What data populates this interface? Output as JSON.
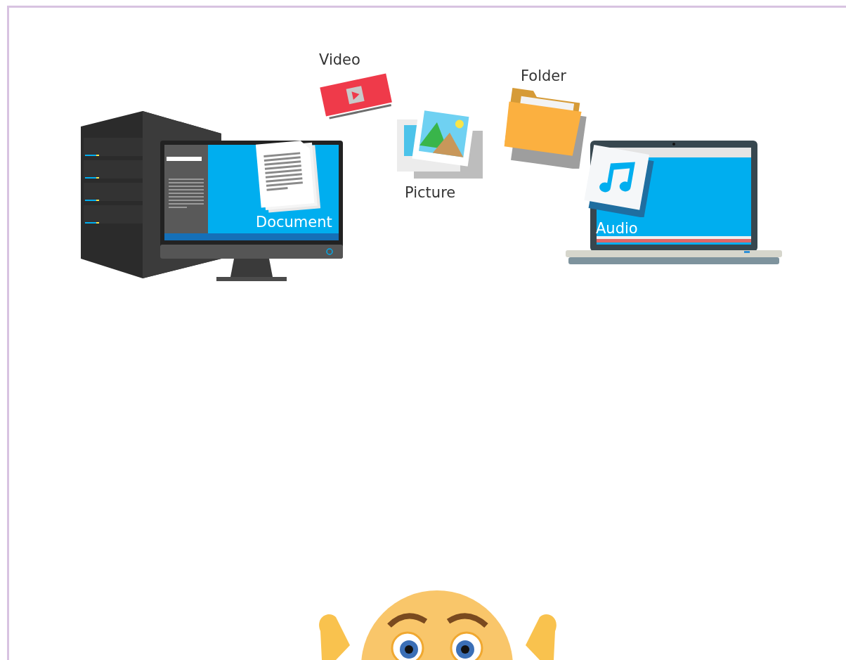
{
  "items": [
    {
      "kind": "video",
      "label": "Video"
    },
    {
      "kind": "folder",
      "label": "Folder"
    },
    {
      "kind": "document",
      "label": "Document"
    },
    {
      "kind": "picture",
      "label": "Picture"
    },
    {
      "kind": "audio",
      "label": "Audio"
    }
  ]
}
